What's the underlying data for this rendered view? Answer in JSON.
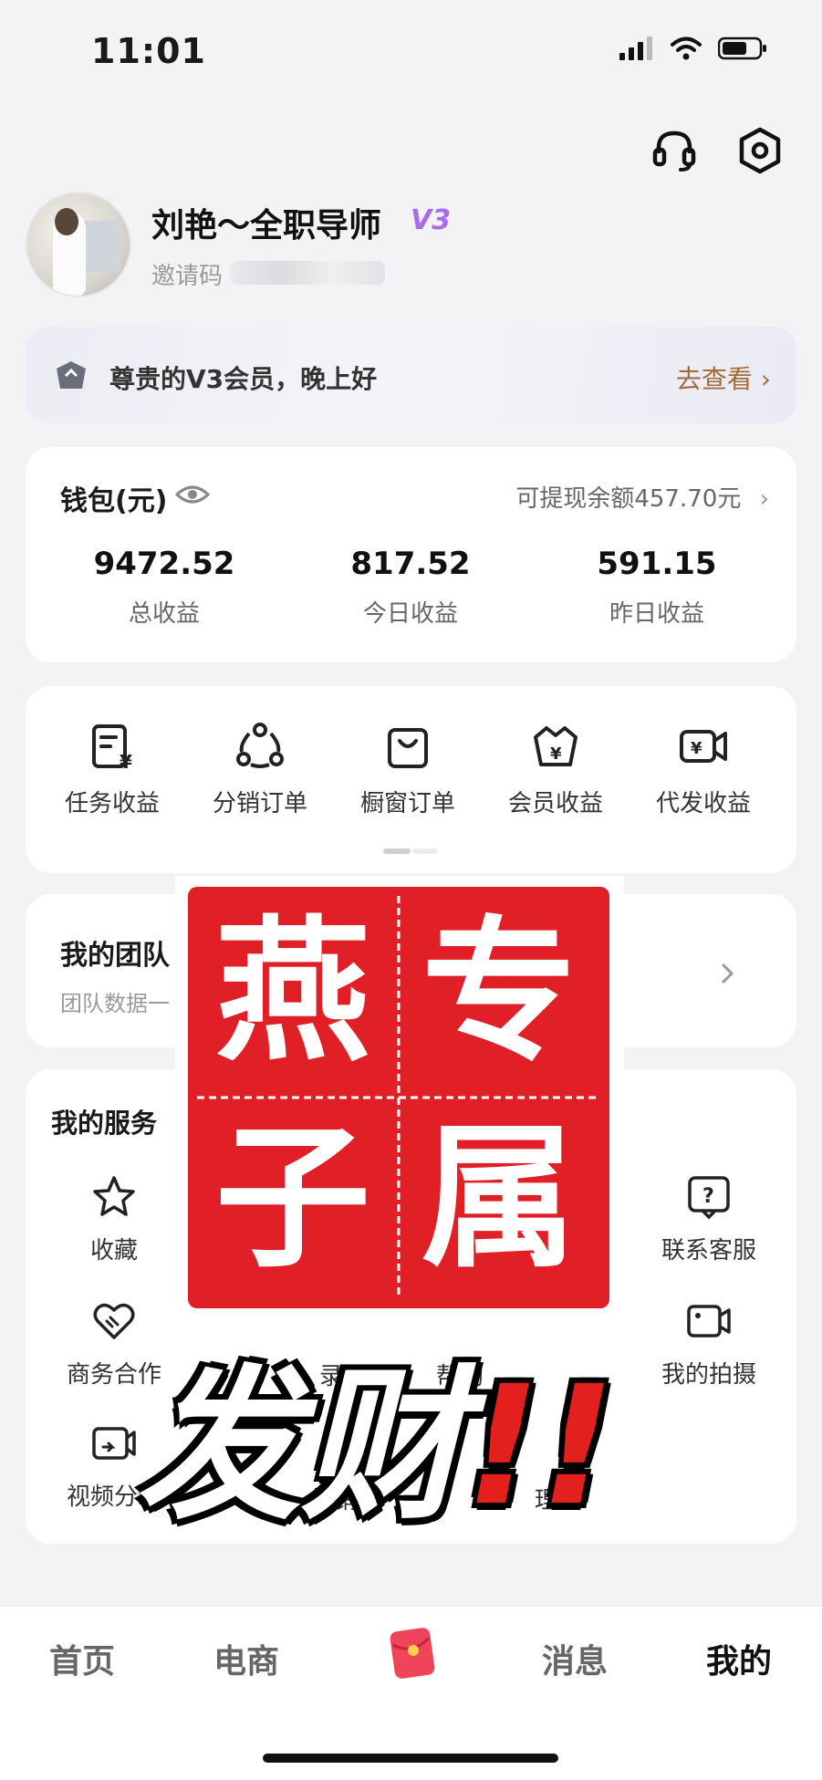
{
  "status_bar": {
    "time": "11:01"
  },
  "profile": {
    "name": "刘艳～全职导师",
    "level_badge": "V3",
    "invite_label": "邀请码"
  },
  "banner": {
    "text": "尊贵的V3会员，晚上好",
    "link": "去查看"
  },
  "wallet": {
    "title": "钱包(元)",
    "withdrawable": "可提现余额457.70元",
    "stats": [
      {
        "value": "9472.52",
        "label": "总收益"
      },
      {
        "value": "817.52",
        "label": "今日收益"
      },
      {
        "value": "591.15",
        "label": "昨日收益"
      }
    ]
  },
  "orders": [
    {
      "label": "任务收益",
      "icon": "task-income-icon"
    },
    {
      "label": "分销订单",
      "icon": "distribution-icon"
    },
    {
      "label": "橱窗订单",
      "icon": "shop-bag-icon"
    },
    {
      "label": "会员收益",
      "icon": "member-income-icon"
    },
    {
      "label": "代发收益",
      "icon": "video-yen-icon"
    }
  ],
  "team": {
    "title": "我的团队",
    "subtitle": "团队数据一"
  },
  "services": {
    "title": "我的服务",
    "items": [
      {
        "label": "收藏",
        "icon": "star-icon"
      },
      {
        "label": "联系客服",
        "icon": "help-icon"
      },
      {
        "label": "商务合作",
        "icon": "heart-handshake-icon"
      },
      {
        "label": "录",
        "icon": ""
      },
      {
        "label": "帮助",
        "icon": ""
      },
      {
        "label": "我的拍摄",
        "icon": "camera-icon"
      },
      {
        "label": "视频分发",
        "icon": "video-share-icon"
      },
      {
        "label": "核销",
        "icon": ""
      },
      {
        "label": "理",
        "icon": ""
      }
    ]
  },
  "overlay": {
    "stamp_chars": [
      "燕",
      "专",
      "子",
      "属"
    ],
    "caption": "发财",
    "exclaim": "!!"
  },
  "tabbar": {
    "tabs": [
      "首页",
      "电商",
      "消息",
      "我的"
    ],
    "active": "我的"
  },
  "colors": {
    "accent_purple": "#a86cf0",
    "stamp_red": "#e01f27",
    "link_brown": "#a36b3a"
  }
}
